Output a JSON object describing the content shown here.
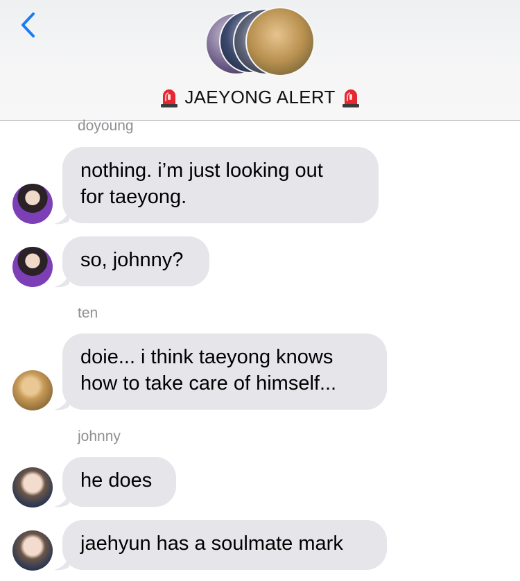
{
  "header": {
    "title": "JAEYONG ALERT",
    "back_icon": "chevron-left-icon",
    "siren_icon": "police-light-icon",
    "accent_color": "#1a7cf5"
  },
  "messages": [
    {
      "sender": "doyoung",
      "text": "nothing. i’m just looking out\nfor taeyong."
    },
    {
      "sender": "",
      "text": "so, johnny?"
    },
    {
      "sender": "ten",
      "text": "doie... i think taeyong knows\nhow to take care of himself..."
    },
    {
      "sender": "johnny",
      "text": "he does"
    },
    {
      "sender": "",
      "text": "jaehyun has a soulmate mark"
    }
  ],
  "colors": {
    "bubble": "#e5e5ea",
    "sender_label": "#8e8e93",
    "header_bg": "#f7f7f7"
  }
}
